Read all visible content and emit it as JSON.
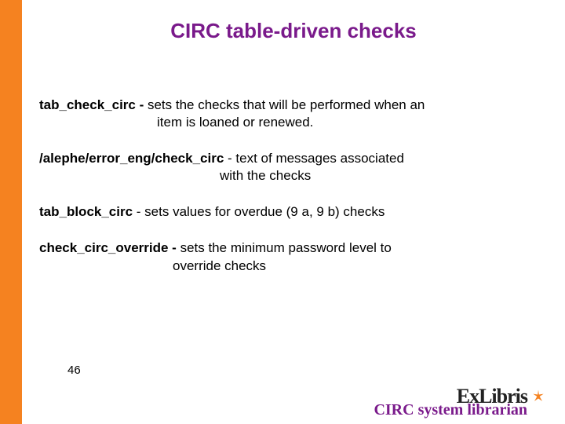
{
  "title": "CIRC table-driven checks",
  "entries": [
    {
      "label": "tab_check_circ - ",
      "desc": "sets the checks that will be performed when an",
      "cont": "item is loaned or renewed."
    },
    {
      "label": "/alephe/error_eng/check_circ ",
      "desc": " - text of messages associated",
      "cont": "with the checks"
    },
    {
      "label": "tab_block_circ ",
      "desc": " - sets values for overdue (9 a, 9 b) checks",
      "cont": ""
    },
    {
      "label": "check_circ_override - ",
      "desc": "sets the minimum password level to",
      "cont": "override checks"
    }
  ],
  "page_number": "46",
  "footer": "CIRC system librarian",
  "logo": {
    "text": "ExLibris"
  }
}
